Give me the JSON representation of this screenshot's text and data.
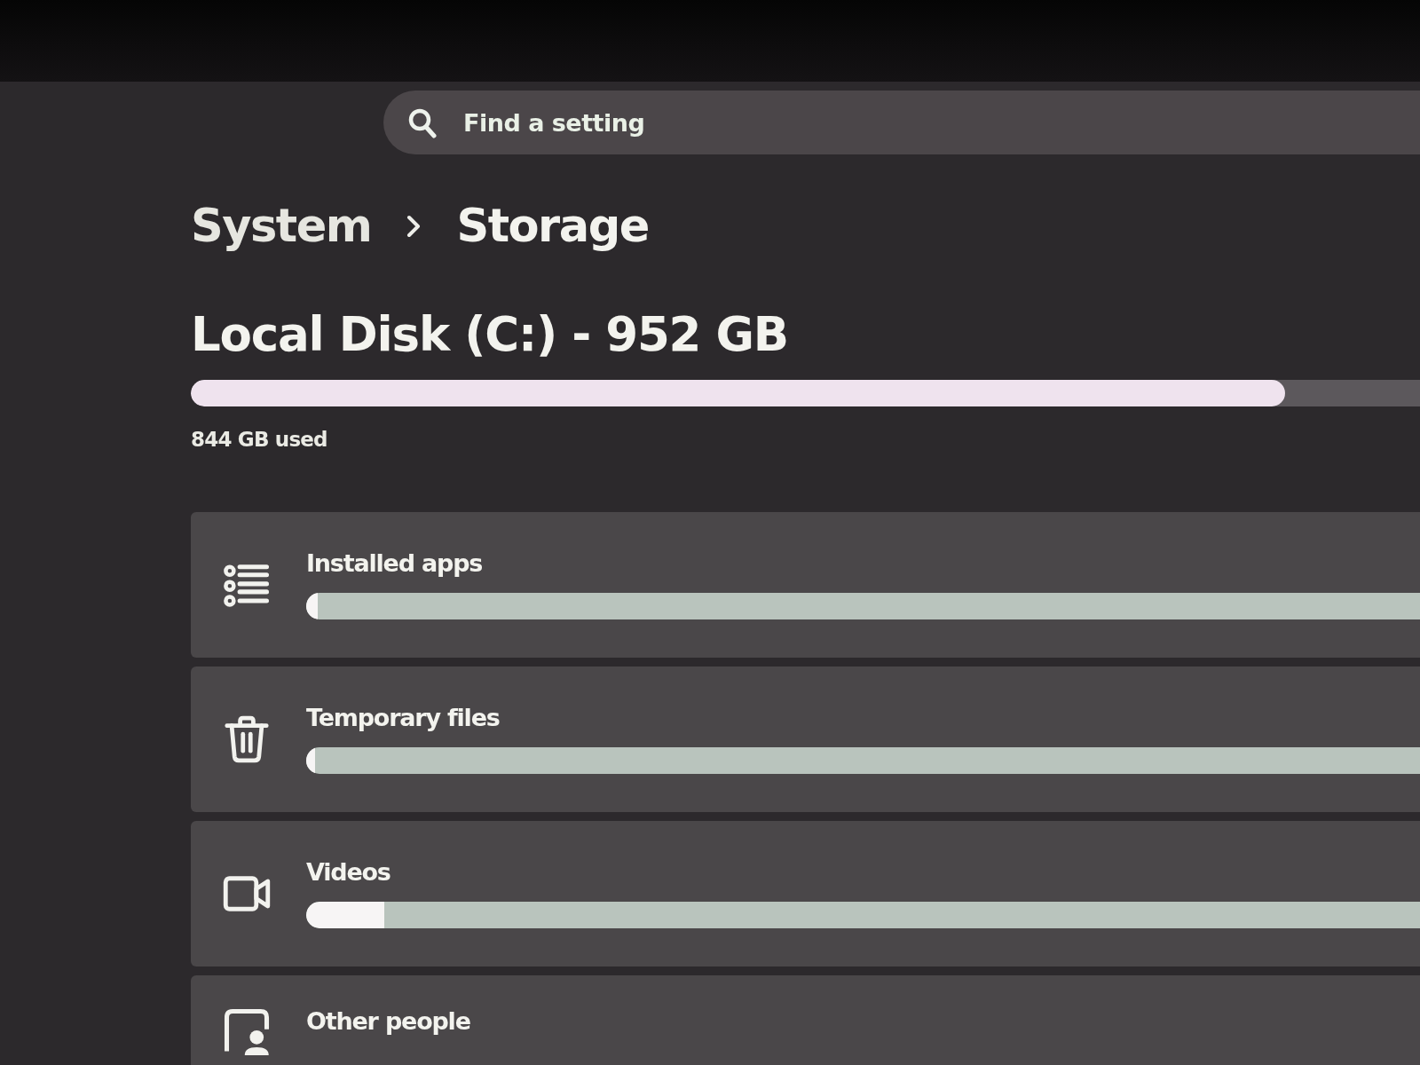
{
  "search": {
    "placeholder": "Find a setting"
  },
  "breadcrumb": [
    {
      "label": "System"
    },
    {
      "label": "Storage"
    }
  ],
  "disk": {
    "title": "Local Disk (C:) - 952 GB",
    "level": 0.89,
    "used": "844 GB used"
  },
  "categories": [
    {
      "kind": "apps",
      "name": "Installed apps",
      "level": 0.01
    },
    {
      "kind": "temp",
      "name": "Temporary files",
      "level": 0.006
    },
    {
      "kind": "videos",
      "name": "Videos",
      "level": 0.07
    },
    {
      "kind": "people",
      "name": "Other people"
    }
  ]
}
